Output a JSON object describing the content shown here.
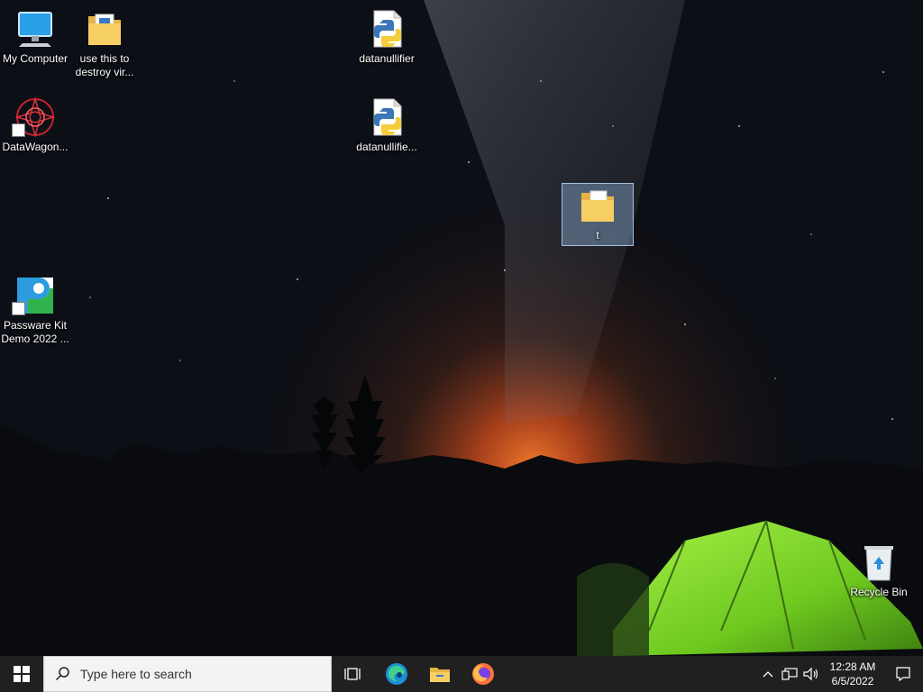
{
  "desktop": {
    "icons": [
      {
        "label": "My Computer"
      },
      {
        "label": "use this to destroy vir..."
      },
      {
        "label": "datanullifier"
      },
      {
        "label": "DataWagon..."
      },
      {
        "label": "datanullifie..."
      },
      {
        "label": "t"
      },
      {
        "label": "Passware Kit Demo 2022 ..."
      },
      {
        "label": "Recycle Bin"
      }
    ],
    "wallpaper": {
      "sky": "#0c0f16",
      "glow": "#e0622a",
      "tent": "#7bd12a"
    }
  },
  "taskbar": {
    "search_placeholder": "Type here to search",
    "pinned": [
      "task-view",
      "edge",
      "file-explorer",
      "firefox"
    ],
    "clock": {
      "time": "12:28 AM",
      "date": "6/5/2022"
    }
  }
}
